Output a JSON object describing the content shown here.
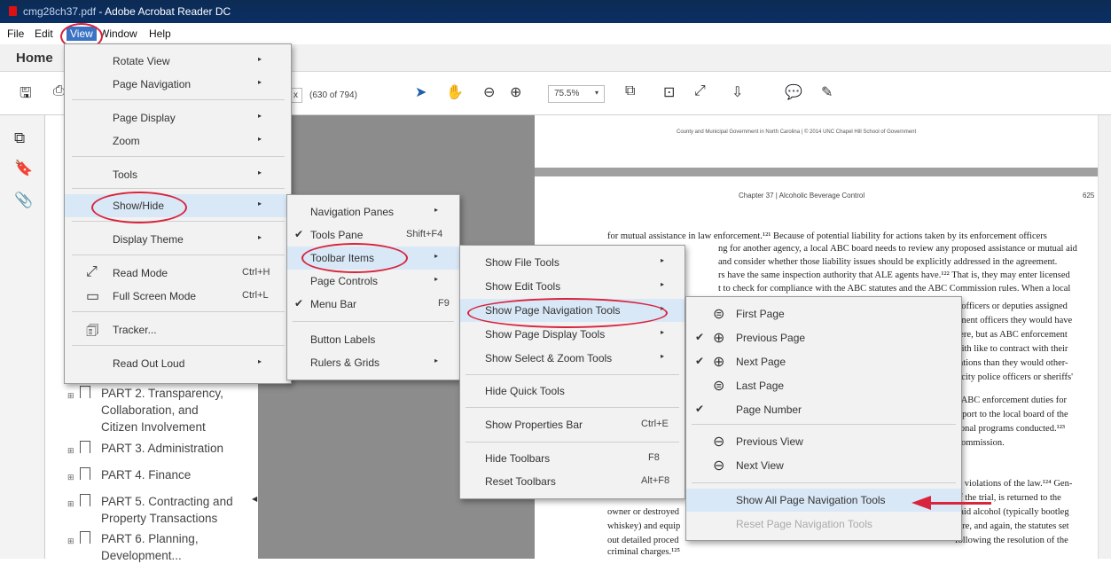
{
  "window": {
    "doc_name": "cmg28ch37.pdf",
    "app_title": "- Adobe Acrobat Reader DC"
  },
  "menubar": {
    "items": [
      "File",
      "Edit",
      "View",
      "Window",
      "Help"
    ]
  },
  "tabs": {
    "home": "Home"
  },
  "toolbar": {
    "page_field": "x",
    "page_count": "(630 of 794)",
    "zoom": "75.5%"
  },
  "bookmarks": [
    {
      "label": "PART 2. Transparency, Collaboration, and Citizen Involvement"
    },
    {
      "label": "PART 3. Administration"
    },
    {
      "label": "PART 4. Finance"
    },
    {
      "label": "PART 5. Contracting and Property Transactions"
    },
    {
      "label": "PART 6. Planning, Development..."
    }
  ],
  "view_menu": {
    "rotate_view": "Rotate View",
    "page_navigation": "Page Navigation",
    "page_display": "Page Display",
    "zoom": "Zoom",
    "tools": "Tools",
    "show_hide": "Show/Hide",
    "display_theme": "Display Theme",
    "read_mode": "Read Mode",
    "read_mode_shortcut": "Ctrl+H",
    "full_screen": "Full Screen Mode",
    "full_screen_shortcut": "Ctrl+L",
    "tracker": "Tracker...",
    "read_out_loud": "Read Out Loud"
  },
  "showhide_menu": {
    "navigation_panes": "Navigation Panes",
    "tools_pane": "Tools Pane",
    "tools_pane_shortcut": "Shift+F4",
    "toolbar_items": "Toolbar Items",
    "page_controls": "Page Controls",
    "menu_bar": "Menu Bar",
    "menu_bar_shortcut": "F9",
    "button_labels": "Button Labels",
    "rulers_grids": "Rulers & Grids"
  },
  "toolbaritems_menu": {
    "show_file_tools": "Show File Tools",
    "show_edit_tools": "Show Edit Tools",
    "show_page_nav_tools": "Show Page Navigation Tools",
    "show_page_display_tools": "Show Page Display Tools",
    "show_select_zoom_tools": "Show Select & Zoom Tools",
    "hide_quick_tools": "Hide Quick Tools",
    "show_properties_bar": "Show Properties Bar",
    "show_properties_bar_shortcut": "Ctrl+E",
    "hide_toolbars": "Hide Toolbars",
    "hide_toolbars_shortcut": "F8",
    "reset_toolbars": "Reset Toolbars",
    "reset_toolbars_shortcut": "Alt+F8"
  },
  "pagenav_menu": {
    "first_page": "First Page",
    "previous_page": "Previous Page",
    "next_page": "Next Page",
    "last_page": "Last Page",
    "page_number": "Page Number",
    "previous_view": "Previous View",
    "next_view": "Next View",
    "show_all": "Show All Page Navigation Tools",
    "reset": "Reset Page Navigation Tools"
  },
  "document": {
    "running_head": "County and Municipal Government in North Carolina  |  © 2014 UNC Chapel Hill School of Government",
    "chapter_head": "Chapter 37  |  Alcoholic Beverage Control",
    "page_num": "625",
    "lines": [
      "for mutual assistance in law enforcement.¹²¹ Because of potential liability for actions taken by its enforcement officers",
      "ng for another agency, a local ABC board needs to review any proposed assistance or mutual aid",
      "and consider whether those liability issues should be explicitly addressed in the agreement.",
      "rs have the same inspection authority that ALE agents have.¹²² That is, they may enter licensed",
      "t to check for compliance with the ABC statutes and the ABC Commission rules. When a local",
      "e officers or deputies assigned",
      "ement officers they would have",
      "here, but as ABC enforcement",
      "with like to contract with their",
      "cations than they would other-",
      "e city police officers or sheriffs'",
      "e ABC enforcement duties for",
      "report to the local board of the",
      "tional programs conducted.¹²³",
      "Commission.",
      "to violations of the law.¹²⁴ Gen-",
      "of the trial, is returned to the",
      "paid alcohol (typically bootleg",
      "ture, and again, the statutes set",
      "following the resolution of the",
      "owner or destroyed",
      "whiskey) and equip",
      "out detailed proced",
      "criminal charges.¹²⁵"
    ]
  }
}
